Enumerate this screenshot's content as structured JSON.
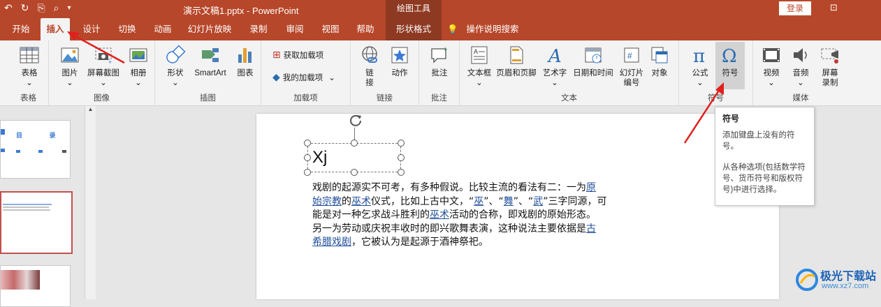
{
  "titlebar": {
    "doc_title": "演示文稿1.pptx - PowerPoint",
    "context_group": "绘图工具",
    "login": "登录"
  },
  "tabs": [
    "开始",
    "插入",
    "设计",
    "切换",
    "动画",
    "幻灯片放映",
    "录制",
    "审阅",
    "视图",
    "帮助",
    "形状格式",
    "操作说明搜索"
  ],
  "active_tab": "插入",
  "ribbon": {
    "table": {
      "btn": "表格",
      "group": "表格"
    },
    "images": {
      "picture": "图片",
      "screenshot": "屏幕截图",
      "album": "相册",
      "group": "图像"
    },
    "illus": {
      "shapes": "形状",
      "smartart": "SmartArt",
      "chart": "图表",
      "group": "插图"
    },
    "addins": {
      "get": "获取加载项",
      "my": "我的加载项",
      "group": "加载项"
    },
    "links": {
      "link1": "链",
      "link2": "接",
      "action": "动作",
      "group": "链接"
    },
    "comments": {
      "comment": "批注",
      "group": "批注"
    },
    "text": {
      "textbox": "文本框",
      "header": "页眉和页脚",
      "wordart": "艺术字",
      "datetime": "日期和时间",
      "slidenum1": "幻灯片",
      "slidenum2": "编号",
      "object": "对象",
      "group": "文本"
    },
    "symbols": {
      "equation": "公式",
      "symbol": "符号",
      "group": "符号"
    },
    "media": {
      "video": "视频",
      "audio": "音频",
      "rec1": "屏幕",
      "rec2": "录制",
      "group": "媒体"
    }
  },
  "thumbnail": {
    "heading": "目 录"
  },
  "slide": {
    "textbox": "Xj",
    "p1": "戏剧的起源实不可考，有多种假说。比较主流的看法有二：一为",
    "p1_link": "原",
    "line2_link1": "始宗教",
    "line2_a": "的",
    "line2_link2": "巫术",
    "line2_b": "仪式，比如上古中文，“",
    "line2_link3": "巫",
    "line2_c": "”、“",
    "line2_link4": "舞",
    "line2_d": "”、“",
    "line2_link5": "武",
    "line2_e": "”三字同源，可",
    "line3_a": "能是对一种乞求战斗胜利的",
    "line3_link": "巫术",
    "line3_b": "活动的合称，即戏剧的原始形态。",
    "line4_a": "另一为劳动或庆祝丰收时的即兴歌舞表演，这种说法主要依据是",
    "line4_link": "古",
    "line5_link": "希腊戏剧",
    "line5_a": "，它被认为是起源于酒神祭祀。"
  },
  "tooltip": {
    "title": "符号",
    "desc1": "添加键盘上没有的符号。",
    "desc2": "从各种选项(包括数学符号、货币符号和版权符号)中进行选择。"
  },
  "watermark": {
    "brand": "极光下载站",
    "url": "www.xz7.com"
  },
  "colors": {
    "accent": "#b7472a",
    "context": "#8e3922",
    "link": "#1f4e99",
    "arrow": "#e0201c"
  }
}
